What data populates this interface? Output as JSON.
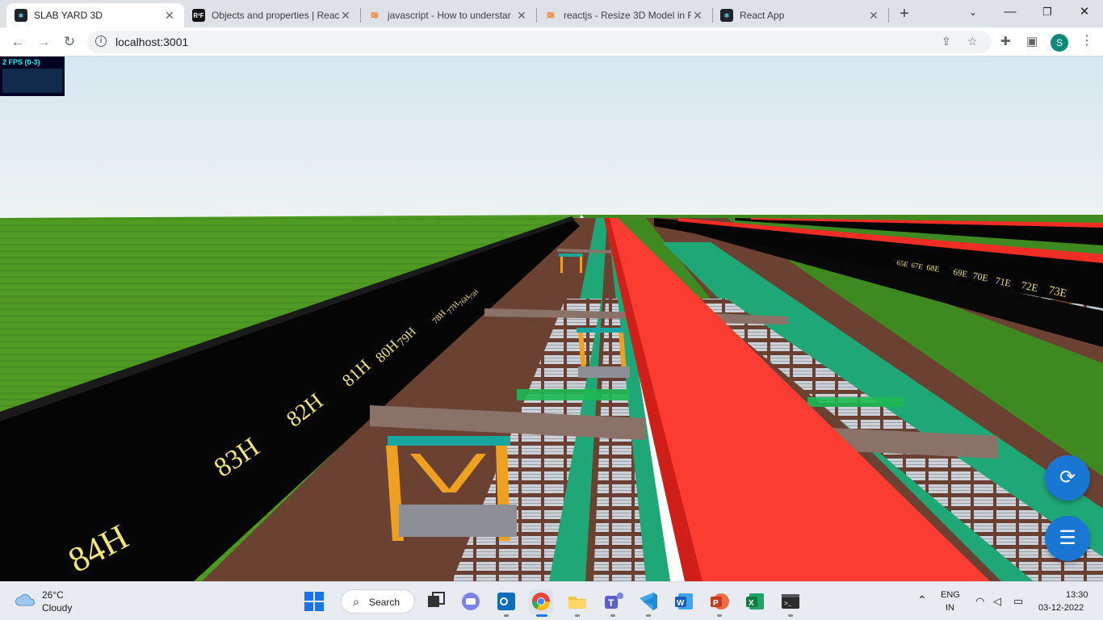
{
  "browser": {
    "tabs": [
      {
        "title": "SLAB YARD 3D",
        "icon": "react-icon",
        "active": true
      },
      {
        "title": "Objects and properties | Reac",
        "icon": "r3f-icon",
        "active": false
      },
      {
        "title": "javascript - How to understar",
        "icon": "stackoverflow-icon",
        "active": false
      },
      {
        "title": "reactjs - Resize 3D Model in R",
        "icon": "stackoverflow-icon",
        "active": false
      },
      {
        "title": "React App",
        "icon": "react-icon",
        "active": false
      }
    ],
    "url": "localhost:3001",
    "profile_initial": "S",
    "r3f_badge": "R³F"
  },
  "scene": {
    "fps_label": "2 FPS (0-3)",
    "left_bay_labels": [
      "84H",
      "83H",
      "82H",
      "81H",
      "80H",
      "79H",
      "78H",
      "77H",
      "76H",
      "75H"
    ],
    "right_bay_labels": [
      "65E",
      "67E",
      "68E",
      "69E",
      "70E",
      "71E",
      "72E",
      "73E"
    ],
    "colors": {
      "sky_top": "#d6e7f0",
      "sky_bottom": "#edf2f2",
      "grass": "#4f9a22",
      "red_beam": "#fa3c32",
      "green_floor": "#1fa777",
      "fab": "#1976d2"
    }
  },
  "controls": {
    "refresh_icon": "refresh-icon",
    "settings_icon": "tune-icon"
  },
  "taskbar": {
    "weather_temp": "26°C",
    "weather_desc": "Cloudy",
    "search_label": "Search",
    "lang_line1": "ENG",
    "lang_line2": "IN",
    "time": "13:30",
    "date": "03-12-2022"
  }
}
